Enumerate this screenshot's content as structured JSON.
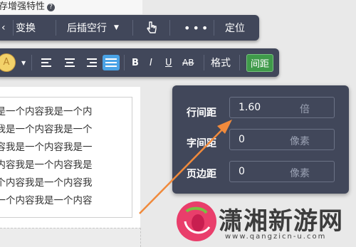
{
  "top_label": "存增强特性",
  "toolbar1": {
    "items": [
      "变换",
      "后插空行",
      "定位"
    ]
  },
  "toolbar2": {
    "bold": "B",
    "italic": "I",
    "underline": "U",
    "strike": "AB",
    "format": "格式",
    "spacing": "间距"
  },
  "content_lines": [
    "我是一个内容我是一个内",
    "容我是一个内容我是一个",
    "内容我是一个内容我是一",
    "个内容我是一个内容我是",
    "一个内容我是一个内容我",
    "是一个内容我是一个内容"
  ],
  "spacing_panel": {
    "line_spacing_label": "行间距",
    "line_spacing_value": "1.60",
    "line_spacing_unit": "倍",
    "char_spacing_label": "字间距",
    "char_spacing_value": "0",
    "char_spacing_unit": "像素",
    "page_margin_label": "页边距",
    "page_margin_value": "0",
    "page_margin_unit": "像素"
  },
  "watermark": {
    "text": "潇湘新游网",
    "url": "www.qangzicn-u.com"
  },
  "colors": {
    "toolbar_bg": "#41475a",
    "spacing_button_bg": "#3f9a4a",
    "arrow": "#f08a3c",
    "logo": "#e93e6b"
  }
}
